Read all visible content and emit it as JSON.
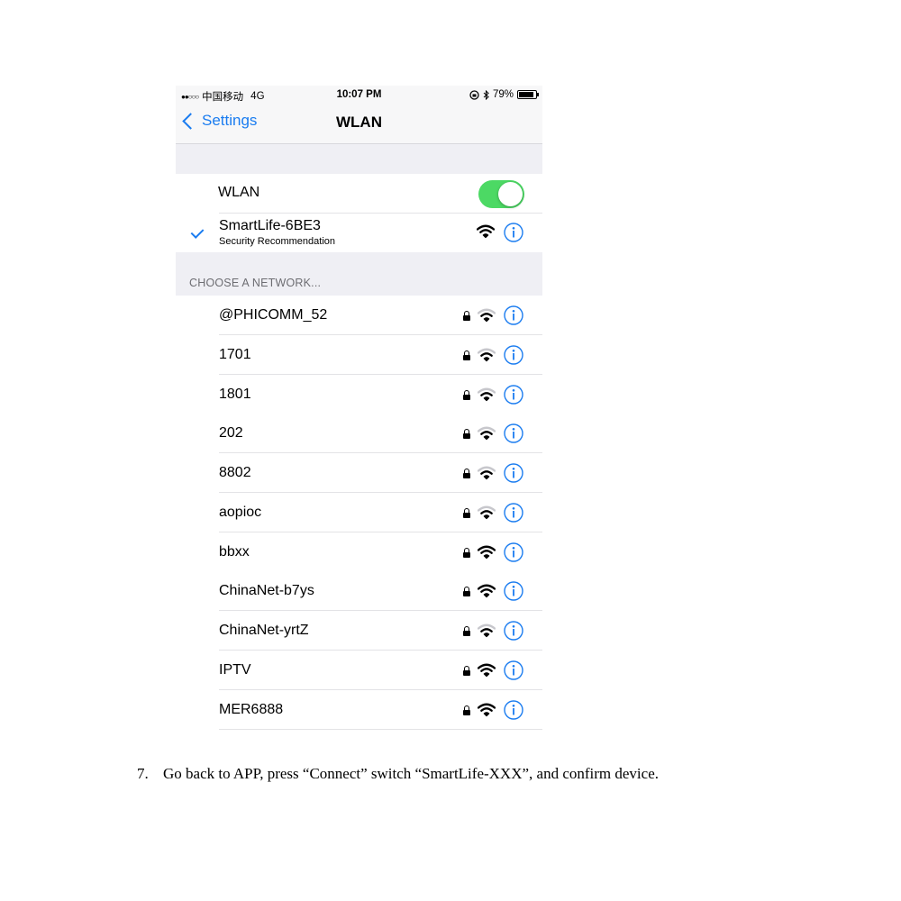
{
  "status_bar": {
    "signal": "●●○○○",
    "carrier": "中国移动",
    "network": "4G",
    "time": "10:07 PM",
    "battery": "79%",
    "battery_level": 0.79
  },
  "nav": {
    "back_label": "Settings",
    "title": "WLAN"
  },
  "wlan": {
    "label": "WLAN",
    "enabled": true,
    "toggle_color": "#4cd964"
  },
  "connected": {
    "name": "SmartLife-6BE3",
    "subtitle": "Security Recommendation"
  },
  "section_header": "CHOOSE A NETWORK...",
  "networks": [
    {
      "name": "@PHICOMM_52",
      "locked": true,
      "strength": 2
    },
    {
      "name": "1701",
      "locked": true,
      "strength": 2
    },
    {
      "name": "1801",
      "locked": true,
      "strength": 2
    },
    {
      "name": "202",
      "locked": true,
      "strength": 2
    },
    {
      "name": "8802",
      "locked": true,
      "strength": 2
    },
    {
      "name": "aopioc",
      "locked": true,
      "strength": 2
    },
    {
      "name": "bbxx",
      "locked": true,
      "strength": 3
    },
    {
      "name": "ChinaNet-b7ys",
      "locked": true,
      "strength": 3
    },
    {
      "name": "ChinaNet-yrtZ",
      "locked": true,
      "strength": 2
    },
    {
      "name": "IPTV",
      "locked": true,
      "strength": 3
    },
    {
      "name": "MER6888",
      "locked": true,
      "strength": 3
    }
  ],
  "caption": {
    "number": "7.",
    "text": "Go back to APP, press “Connect” switch “SmartLife-XXX”, and confirm device."
  },
  "colors": {
    "accent": "#1a7cf0",
    "grouped_background": "#efeff4",
    "toggle_on": "#4cd964"
  }
}
